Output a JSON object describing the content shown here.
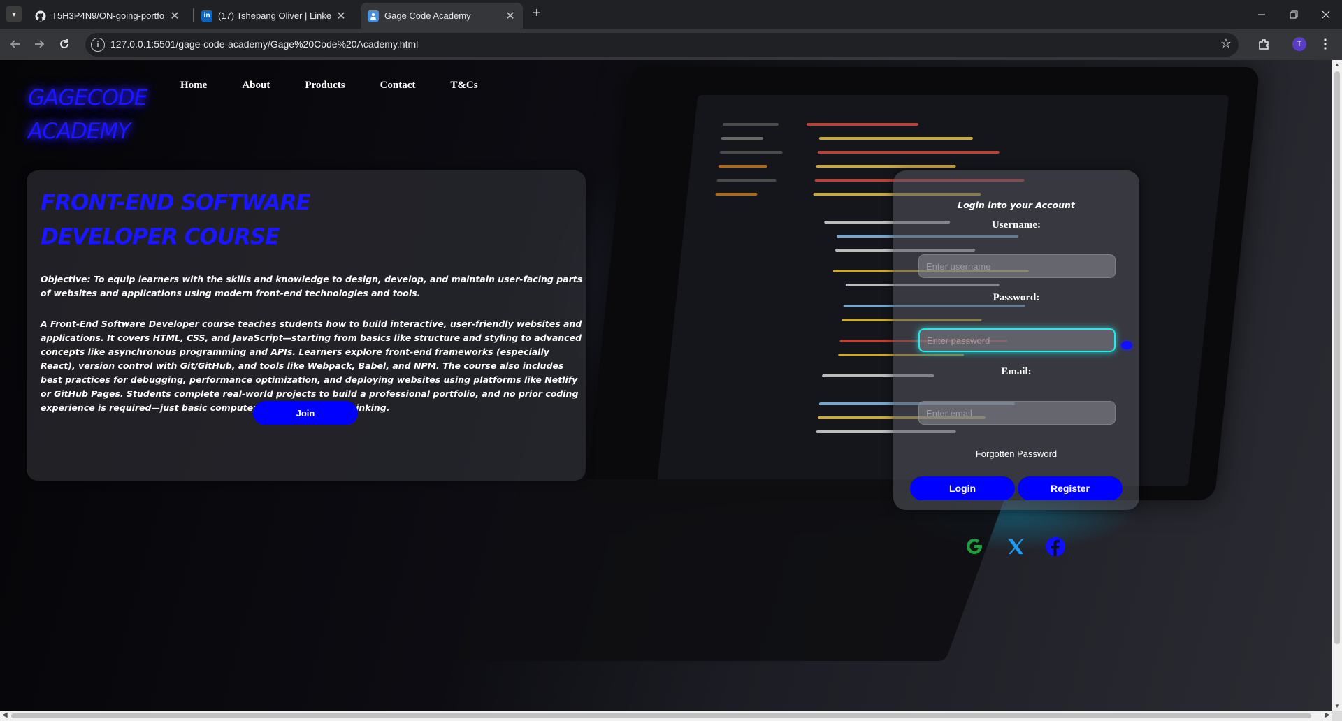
{
  "browser": {
    "tabs": [
      {
        "title": "T5H3P4N9/ON-going-portfolio",
        "icon": "github-icon"
      },
      {
        "title": "(17) Tshepang Oliver | LinkedIn",
        "icon": "linkedin-icon",
        "icon_text": "in"
      },
      {
        "title": "Gage Code Academy",
        "icon": "site-icon"
      }
    ],
    "url": "127.0.0.1:5501/gage-code-academy/Gage%20Code%20Academy.html",
    "profile_initial": "T",
    "tab_close_glyph": "✕",
    "new_tab_glyph": "+"
  },
  "site": {
    "logo_line1": "GAGECODE",
    "logo_line2": "ACADEMY",
    "nav": [
      "Home",
      "About",
      "Products",
      "Contact",
      "T&Cs"
    ],
    "course": {
      "title_line1": "FRONT-END SOFTWARE",
      "title_line2": "DEVELOPER COURSE",
      "objective": "Objective: To equip learners with the skills and knowledge to design, develop, and maintain user-facing parts of websites and applications using modern front-end technologies and tools.",
      "description": "A Front-End Software Developer course teaches students how to build interactive, user-friendly websites and applications. It covers HTML, CSS, and JavaScript—starting from basics like structure and styling to advanced concepts like asynchronous programming and APIs. Learners explore front-end frameworks (especially React), version control with Git/GitHub, and tools like Webpack, Babel, and NPM. The course also includes best practices for debugging, performance optimization, and deploying websites using platforms like Netlify or GitHub Pages. Students complete real-world projects to build a professional portfolio, and no prior coding experience is required—just basic computer skills and logical thinking.",
      "join_label": "Join"
    },
    "login": {
      "heading": "Login into your Account",
      "username_label": "Username:",
      "username_placeholder": "Enter username",
      "password_label": "Password:",
      "password_placeholder": "Enter password",
      "email_label": "Email:",
      "email_placeholder": "Enter email",
      "forgot_label": "Forgotten Password",
      "login_label": "Login",
      "register_label": "Register",
      "social": [
        "google-icon",
        "x-icon",
        "facebook-icon"
      ]
    }
  },
  "colors": {
    "brand_blue": "#1a16ff",
    "button_blue": "#0000ff",
    "focus_cyan": "#2ee6e6",
    "google_green": "#1e9e3e",
    "x_blue": "#1d9bf0",
    "facebook_blue": "#1010ff"
  }
}
